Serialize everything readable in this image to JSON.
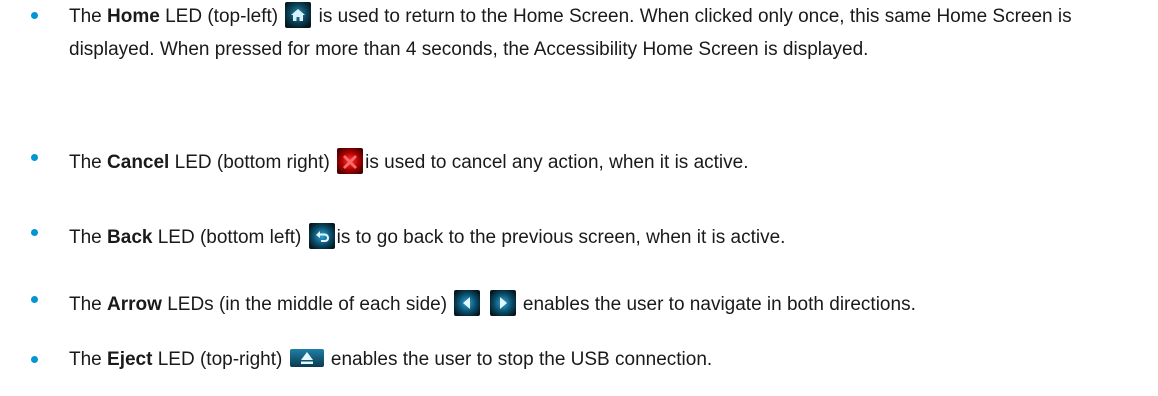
{
  "bullet_color": "#0096d6",
  "items": [
    {
      "pre": "The ",
      "keyword": "Home",
      "mid": " LED (top-left) ",
      "icon": "home-icon",
      "post": " is used to return to the Home Screen. When clicked only once, this same Home Screen is displayed. When pressed for more than 4 seconds, the Accessibility Home Screen is displayed."
    },
    {
      "pre": "The ",
      "keyword": "Cancel",
      "mid": " LED (bottom right) ",
      "icon": "cancel-x-icon",
      "post": "is used to cancel any action, when it is active."
    },
    {
      "pre": "The ",
      "keyword": "Back",
      "mid": " LED (bottom left) ",
      "icon": "back-arrow-icon",
      "post": "is to go back to the previous screen, when it is active."
    },
    {
      "pre": "The ",
      "keyword": "Arrow",
      "mid": " LEDs (in the middle of each side) ",
      "icons": [
        "left-arrow-icon",
        "right-arrow-icon"
      ],
      "post": " enables the user to navigate in both directions."
    },
    {
      "pre": "The ",
      "keyword": "Eject",
      "mid": " LED (top-right) ",
      "icon": "eject-icon",
      "post": " enables the user to stop the USB connection."
    }
  ]
}
